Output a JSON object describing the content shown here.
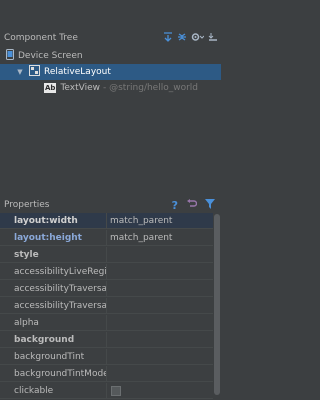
{
  "component_tree": {
    "title": "Component Tree",
    "items": [
      {
        "label": "Device Screen",
        "icon": "device-icon"
      },
      {
        "label": "RelativeLayout",
        "icon": "layout-icon"
      },
      {
        "label": "TextView",
        "sub": "- @string/hello_world",
        "icon_text": "Ab"
      }
    ]
  },
  "properties": {
    "title": "Properties",
    "rows": [
      {
        "name": "layout:width",
        "value": "match_parent"
      },
      {
        "name": "layout:height",
        "value": "match_parent"
      },
      {
        "name": "style",
        "value": ""
      },
      {
        "name": "accessibilityLiveRegion",
        "value": ""
      },
      {
        "name": "accessibilityTraversalAfter",
        "value": ""
      },
      {
        "name": "accessibilityTraversalBefore",
        "value": ""
      },
      {
        "name": "alpha",
        "value": ""
      },
      {
        "name": "background",
        "value": ""
      },
      {
        "name": "backgroundTint",
        "value": ""
      },
      {
        "name": "backgroundTintMode",
        "value": ""
      },
      {
        "name": "clickable",
        "value": ""
      }
    ]
  },
  "colors": {
    "panel_bg": "#3c3f41",
    "selection": "#2d5a85",
    "accent_blue": "#4a90d9",
    "accent_purple": "#9876aa"
  }
}
